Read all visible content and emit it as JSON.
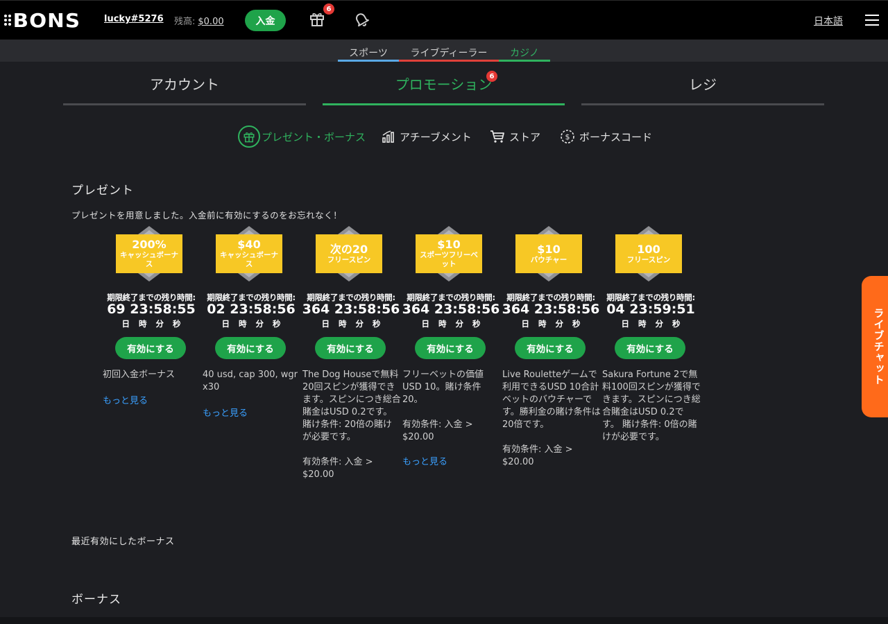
{
  "header": {
    "logo": "BONS",
    "username": "lucky#5276",
    "balance_label": "残高:",
    "balance_value": "$0.00",
    "deposit_label": "入金",
    "gift_badge": "6",
    "language": "日本語"
  },
  "subnav": {
    "items": [
      {
        "label": "スポーツ",
        "color": "#5aa9e6"
      },
      {
        "label": "ライブディーラー",
        "color": "#e0413a"
      },
      {
        "label": "カジノ",
        "color": "#2fb35e"
      }
    ]
  },
  "tabs": [
    {
      "label": "アカウント"
    },
    {
      "label": "プロモーション",
      "badge": "6"
    },
    {
      "label": "レジ"
    }
  ],
  "subtabs": [
    {
      "label": "プレゼント・ボーナス",
      "icon": "gift-icon"
    },
    {
      "label": "アチーブメント",
      "icon": "bar-chart-icon"
    },
    {
      "label": "ストア",
      "icon": "cart-icon"
    },
    {
      "label": "ボーナスコード",
      "icon": "coin-icon"
    }
  ],
  "present": {
    "title": "プレゼント",
    "note": "プレゼントを用意しました。入金前に有効にするのをお忘れなく！",
    "timer_label": "期限終了までの残り時間:",
    "timer_units": "日 時 分 秒",
    "button_label": "有効にする",
    "cards": [
      {
        "main": "200%",
        "sub": "キャッシュボーナス",
        "timer": "69 23:58:55",
        "desc": "初回入金ボーナス",
        "requirement": "",
        "more": "もっと見る"
      },
      {
        "main": "$40",
        "sub": "キャッシュボーナス",
        "timer": "02 23:58:56",
        "desc": "40 usd, cap 300, wgr x30",
        "requirement": "",
        "more": "もっと見る"
      },
      {
        "main": "次の20",
        "sub": "フリースピン",
        "timer": "364 23:58:56",
        "desc": "The Dog Houseで無料20回スピンが獲得できます。スピンにつき総合賭金はUSD 0.2です。 賭け条件: 20倍の賭けが必要です。",
        "requirement": "有効条件: 入金 > $20.00",
        "more": ""
      },
      {
        "main": "$10",
        "sub": "スポーツフリーベット",
        "timer": "364 23:58:56",
        "desc": "フリーベットの価値USD 10。賭け条件20。",
        "requirement": "有効条件: 入金 > $20.00",
        "more": "もっと見る"
      },
      {
        "main": "$10",
        "sub": "バウチャー",
        "timer": "364 23:58:56",
        "desc": "Live Rouletteゲームで利用できるUSD 10合計ベットのバウチャーです。勝利金の賭け条件は20倍です。",
        "requirement": "有効条件: 入金 > $20.00",
        "more": ""
      },
      {
        "main": "100",
        "sub": "フリースピン",
        "timer": "04 23:59:51",
        "desc": "Sakura Fortune 2で無料100回スピンが獲得できます。スピンにつき総合賭金はUSD 0.2です。 賭け条件: 0倍の賭けが必要です。",
        "requirement": "",
        "more": ""
      }
    ]
  },
  "recent": {
    "title": "最近有効にしたボーナス"
  },
  "bonus": {
    "title": "ボーナス"
  },
  "livechat": {
    "label": "ライブチャット"
  },
  "colors": {
    "accent_green": "#1fa34a",
    "tab_green": "#2fb35e",
    "hex_yellow": "#f7c825",
    "link_blue": "#3aa0ff",
    "livechat_orange": "#ff6a1a"
  }
}
